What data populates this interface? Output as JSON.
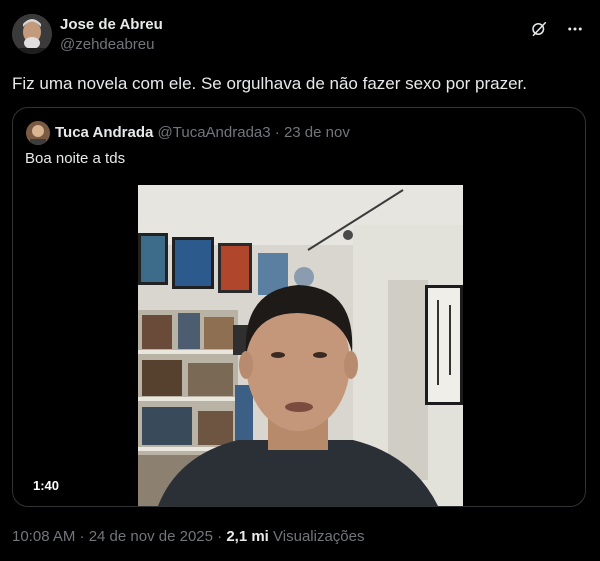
{
  "author": {
    "display_name": "Jose de Abreu",
    "handle": "@zehdeabreu"
  },
  "header_icons": [
    "grok-icon",
    "more-icon"
  ],
  "tweet": {
    "text": "Fiz uma novela com ele. Se orgulhava de não fazer sexo por prazer."
  },
  "quote": {
    "display_name": "Tuca Andrada",
    "handle": "@TucaAndrada3",
    "separator": "·",
    "date": "23 de nov",
    "text": "Boa noite a tds",
    "video_duration": "1:40"
  },
  "footer": {
    "timestamp": "10:08 AM · 24 de nov de 2025 ·",
    "views_count": "2,1 mi",
    "views_label": "Visualizações"
  }
}
